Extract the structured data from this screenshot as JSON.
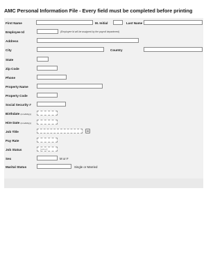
{
  "title": "AMC Personal Information File - Every field must be completed before printing",
  "labels": {
    "first_name": "First Name",
    "m_initial": "M. Initial",
    "last_name": "Last Name",
    "employee_id": "Employee Id",
    "employee_id_note": "(Employee Id will be assigned by the payroll department)",
    "address": "Address",
    "city": "City",
    "country": "Country",
    "state": "State",
    "zip_code": "Zip Code",
    "phone": "Phone",
    "property_name": "Property Name",
    "property_code": "Property Code",
    "ssn": "Social Security #",
    "birthdate": "Birthdate",
    "birthdate_fmt": "(mm/dd/yy)",
    "hire_date": "Hire Date",
    "hire_date_fmt": "(mm/dd/yy)",
    "job_title": "Job Title",
    "pay_rate": "Pay Rate",
    "job_status": "Job Status",
    "sex": "Sex",
    "sex_hint": "M or F",
    "marital_status": "Marital Status",
    "marital_hint": "Single or Married"
  },
  "job_status_placeholder": "[select]"
}
